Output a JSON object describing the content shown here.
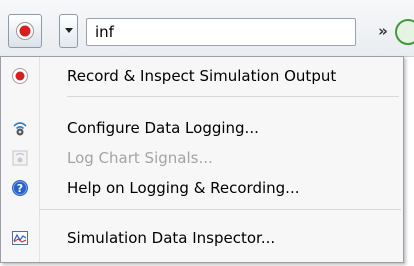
{
  "toolbar": {
    "stop_time_value": "inf",
    "overflow_label": "»"
  },
  "menu": {
    "items": [
      {
        "label": "Record & Inspect Simulation Output",
        "icon": "record-icon",
        "enabled": true
      },
      {
        "label": "Configure Data Logging...",
        "icon": "data-logging-icon",
        "enabled": true
      },
      {
        "label": "Log Chart Signals...",
        "icon": "log-chart-signals-icon",
        "enabled": false
      },
      {
        "label": "Help on Logging & Recording...",
        "icon": "help-icon",
        "enabled": true
      },
      {
        "label": "Simulation Data Inspector...",
        "icon": "simulation-data-inspector-icon",
        "enabled": true
      }
    ]
  },
  "colors": {
    "record_red": "#d62020",
    "help_blue": "#2a62c6",
    "disabled_text": "#a4a4a4"
  }
}
